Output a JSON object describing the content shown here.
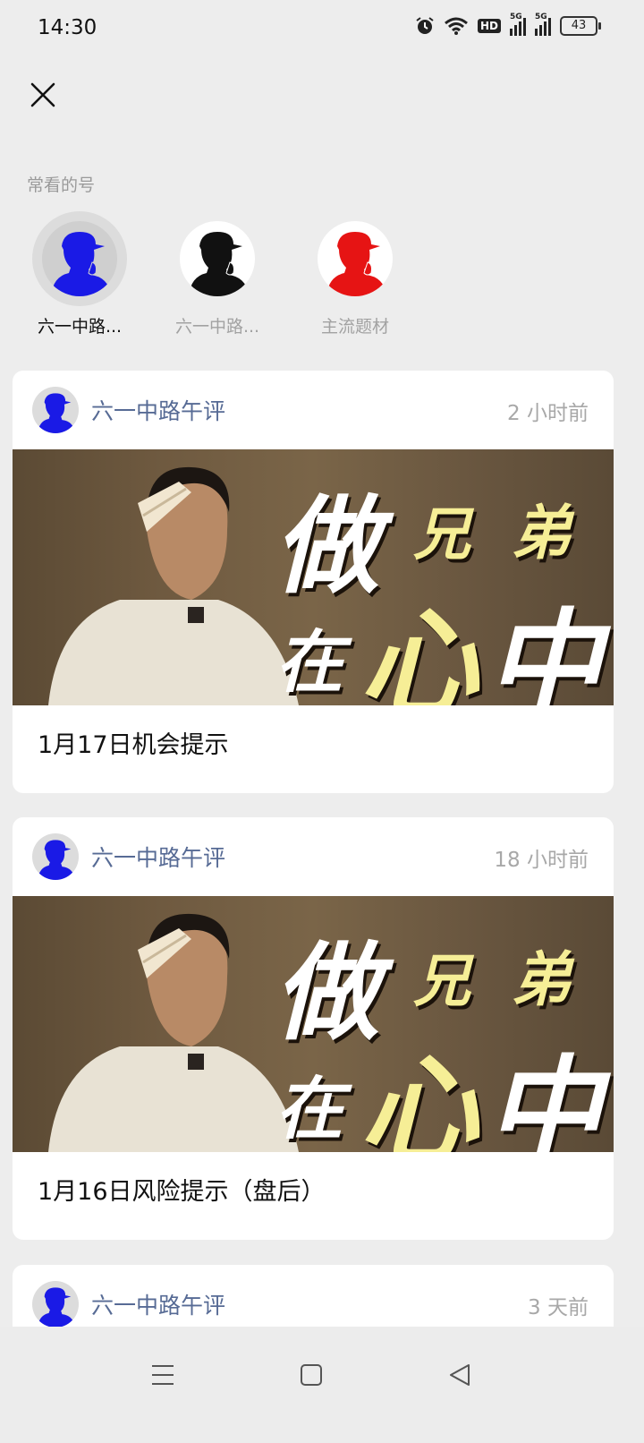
{
  "status_bar": {
    "time": "14:30",
    "hd_label": "HD",
    "network_1": "5G",
    "network_2": "5G",
    "battery": "43"
  },
  "favorites": {
    "label": "常看的号",
    "items": [
      {
        "name": "六一中路...",
        "color": "#1a1ae6"
      },
      {
        "name": "六一中路...",
        "color": "#111111"
      },
      {
        "name": "主流题材",
        "color": "#e61414"
      }
    ]
  },
  "thumb_text": {
    "a": "做",
    "b": "兄",
    "c": "弟",
    "d": "在",
    "e": "心",
    "f": "中"
  },
  "articles": [
    {
      "account": "六一中路午评",
      "time": "2 小时前",
      "title": "1月17日机会提示"
    },
    {
      "account": "六一中路午评",
      "time": "18 小时前",
      "title": "1月16日风险提示（盘后）"
    },
    {
      "account": "六一中路午评",
      "time": "3 天前"
    }
  ],
  "icons": {
    "close": "close-icon",
    "menu": "menu-icon",
    "home": "square-home-icon",
    "back": "triangle-back-icon",
    "alarm": "alarm-icon",
    "wifi": "wifi-icon",
    "signal": "signal-icon",
    "battery": "battery-icon"
  }
}
